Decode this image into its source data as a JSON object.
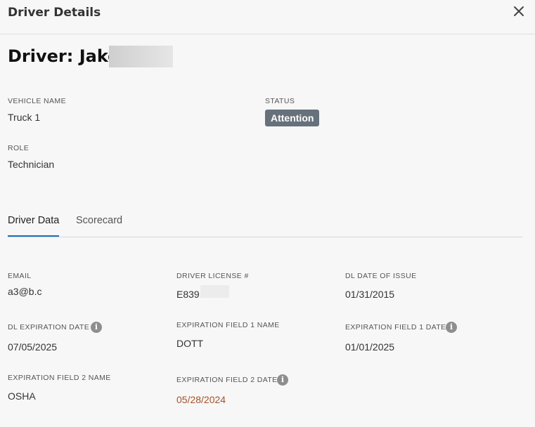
{
  "header": {
    "title": "Driver Details",
    "close_icon": "close-icon"
  },
  "driver": {
    "title": "Driver: Jake"
  },
  "summary": {
    "vehicle_name_label": "VEHICLE NAME",
    "vehicle_name_value": "Truck 1",
    "status_label": "STATUS",
    "status_value": "Attention",
    "status_color": "#66717c",
    "role_label": "ROLE",
    "role_value": "Technician"
  },
  "tabs": [
    {
      "label": "Driver Data",
      "active": true
    },
    {
      "label": "Scorecard",
      "active": false
    }
  ],
  "accent_color": "#1e6fc1",
  "fields": {
    "email_label": "EMAIL",
    "email_value": "a3@b.c",
    "license_label": "DRIVER LICENSE #",
    "license_value": "E839",
    "dl_issue_label": "DL DATE OF ISSUE",
    "dl_issue_value": "01/31/2015",
    "dl_exp_label": "DL EXPIRATION DATE",
    "dl_exp_value": "07/05/2025",
    "exp1_name_label": "EXPIRATION FIELD 1 NAME",
    "exp1_name_value": "DOTT",
    "exp1_date_label": "EXPIRATION FIELD 1 DATE",
    "exp1_date_value": "01/01/2025",
    "exp2_name_label": "EXPIRATION FIELD 2 NAME",
    "exp2_name_value": "OSHA",
    "exp2_date_label": "EXPIRATION FIELD 2 DATE",
    "exp2_date_value": "05/28/2024",
    "expired_color": "#a6512a",
    "info_icon": "info-icon",
    "info_glyph": "i"
  }
}
